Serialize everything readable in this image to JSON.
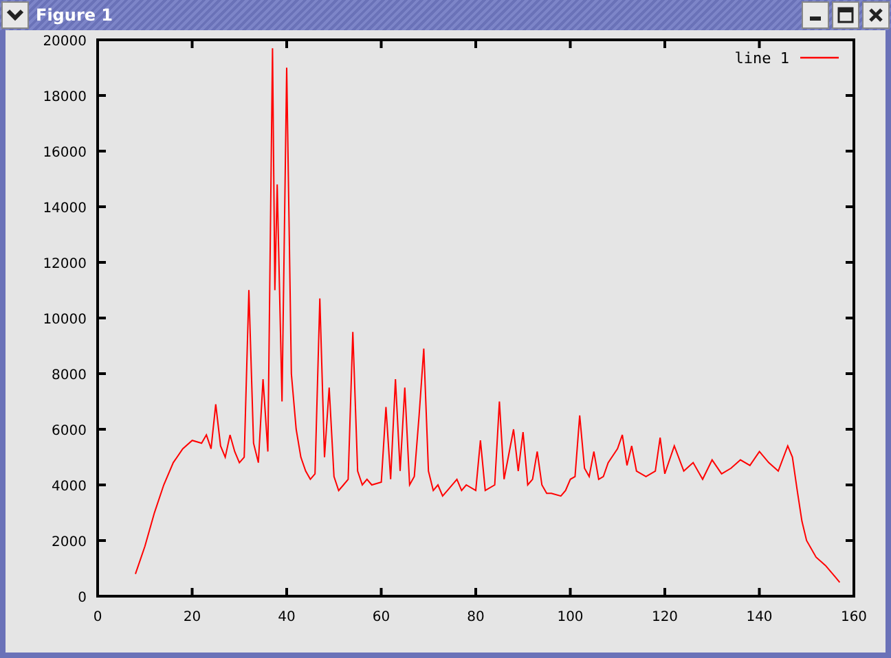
{
  "window": {
    "title": "Figure 1"
  },
  "figure": {
    "chart_data": {
      "type": "line",
      "xlim": [
        0,
        160
      ],
      "ylim": [
        0,
        20000
      ],
      "xticks": [
        0,
        20,
        40,
        60,
        80,
        100,
        120,
        140,
        160
      ],
      "yticks": [
        0,
        2000,
        4000,
        6000,
        8000,
        10000,
        12000,
        14000,
        16000,
        18000,
        20000
      ],
      "x": [
        8,
        10,
        12,
        14,
        16,
        18,
        20,
        22,
        23,
        24,
        25,
        26,
        27,
        28,
        29,
        30,
        31,
        32,
        33,
        34,
        35,
        36,
        37,
        37.5,
        38,
        39,
        40,
        41,
        42,
        43,
        44,
        45,
        46,
        47,
        48,
        49,
        50,
        51,
        52,
        53,
        54,
        55,
        56,
        57,
        58,
        60,
        61,
        62,
        63,
        64,
        65,
        66,
        67,
        68,
        69,
        70,
        71,
        72,
        73,
        74,
        76,
        77,
        78,
        80,
        81,
        82,
        84,
        85,
        86,
        88,
        89,
        90,
        91,
        92,
        93,
        94,
        95,
        96,
        98,
        99,
        100,
        101,
        102,
        103,
        104,
        105,
        106,
        107,
        108,
        110,
        111,
        112,
        113,
        114,
        116,
        118,
        119,
        120,
        122,
        124,
        126,
        128,
        130,
        132,
        134,
        136,
        138,
        140,
        142,
        144,
        146,
        147,
        148,
        149,
        150,
        152,
        154,
        156,
        157
      ],
      "series": [
        {
          "name": "line 1",
          "color": "#ff0000",
          "values": [
            800,
            1800,
            3000,
            4000,
            4800,
            5300,
            5600,
            5500,
            5800,
            5300,
            6900,
            5400,
            5000,
            5800,
            5200,
            4800,
            5000,
            11000,
            5500,
            4800,
            7800,
            5200,
            19700,
            11000,
            14800,
            7000,
            19000,
            8000,
            6000,
            5000,
            4500,
            4200,
            4400,
            10700,
            5000,
            7500,
            4300,
            3800,
            4000,
            4200,
            9500,
            4500,
            4000,
            4200,
            4000,
            4100,
            6800,
            4200,
            7800,
            4500,
            7500,
            4000,
            4300,
            6500,
            8900,
            4500,
            3800,
            4000,
            3600,
            3800,
            4200,
            3800,
            4000,
            3800,
            5600,
            3800,
            4000,
            7000,
            4200,
            6000,
            4500,
            5900,
            4000,
            4200,
            5200,
            4000,
            3700,
            3700,
            3600,
            3800,
            4200,
            4300,
            6500,
            4600,
            4300,
            5200,
            4200,
            4300,
            4800,
            5300,
            5800,
            4700,
            5400,
            4500,
            4300,
            4500,
            5700,
            4400,
            5400,
            4500,
            4800,
            4200,
            4900,
            4400,
            4600,
            4900,
            4700,
            5200,
            4800,
            4500,
            5400,
            5000,
            3800,
            2700,
            2000,
            1400,
            1100,
            700,
            500
          ]
        }
      ]
    }
  }
}
